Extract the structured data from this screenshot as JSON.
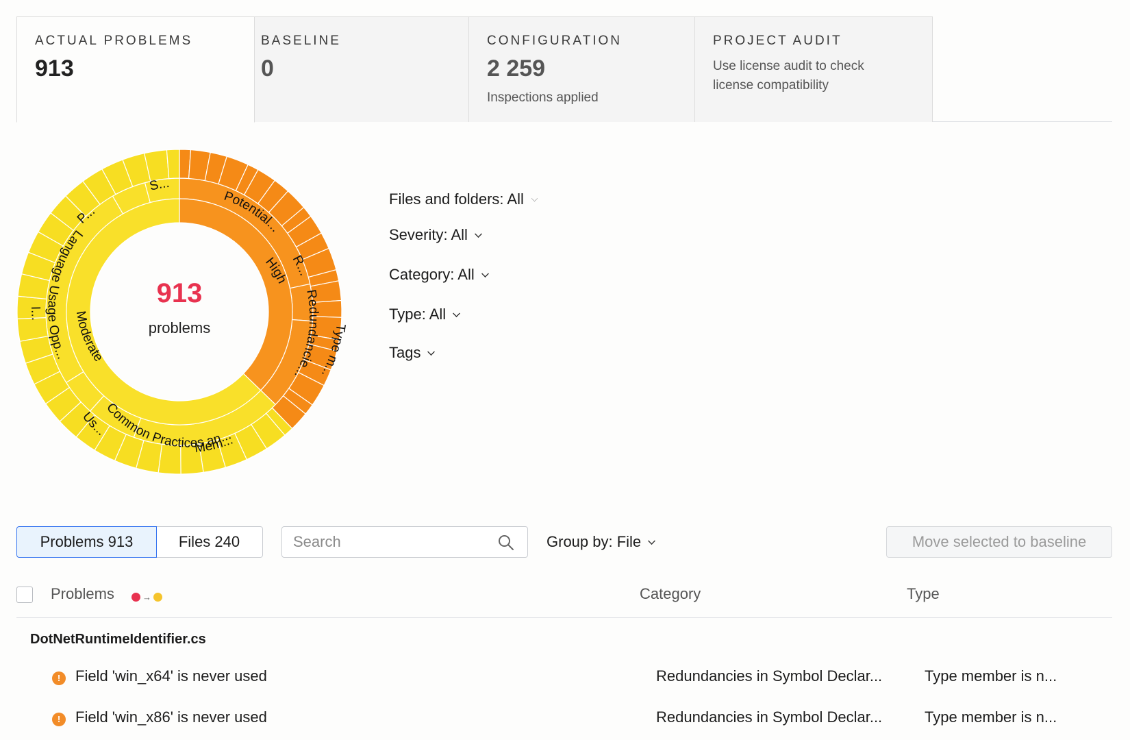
{
  "cards": [
    {
      "title": "ACTUAL PROBLEMS",
      "value": "913"
    },
    {
      "title": "BASELINE",
      "value": "0"
    },
    {
      "title": "CONFIGURATION",
      "value": "2 259",
      "sub": "Inspections applied"
    },
    {
      "title": "PROJECT AUDIT",
      "desc_line1": "Use license audit to check",
      "desc_line2": "license compatibility"
    }
  ],
  "sunburst": {
    "total": "913",
    "total_label": "problems",
    "colors": {
      "high": "#f7931e",
      "moderate": "#f9e02a",
      "high_outer": "#f58a16",
      "moderate_outer": "#f7de22",
      "separator": "#ffffff"
    },
    "inner_labels": {
      "high": "High",
      "moderate": "Moderate"
    },
    "category_labels": {
      "potential": "Potential...",
      "r": "R...",
      "redundancies": "Redundancie...",
      "type": "Type m...",
      "common": "Common Practices an...",
      "mem": "Mem...",
      "us": "Us...",
      "i": "I...",
      "language": "Language Usage Opp...",
      "p": "P...",
      "s": "S..."
    }
  },
  "filters": {
    "files": "Files and folders: All",
    "severity": "Severity: All",
    "category": "Category: All",
    "type": "Type: All",
    "tags": "Tags"
  },
  "toolbar": {
    "problems_tab": "Problems 913",
    "files_tab": "Files 240",
    "search_placeholder": "Search",
    "group_by": "Group by: File",
    "move_button": "Move selected to baseline"
  },
  "table": {
    "col_problems": "Problems",
    "col_category": "Category",
    "col_type": "Type",
    "group": "DotNetRuntimeIdentifier.cs",
    "rows": [
      {
        "problem": "Field 'win_x64' is never used",
        "category": "Redundancies in Symbol Declar...",
        "type": "Type member is n..."
      },
      {
        "problem": "Field 'win_x86' is never used",
        "category": "Redundancies in Symbol Declar...",
        "type": "Type member is n..."
      }
    ]
  }
}
